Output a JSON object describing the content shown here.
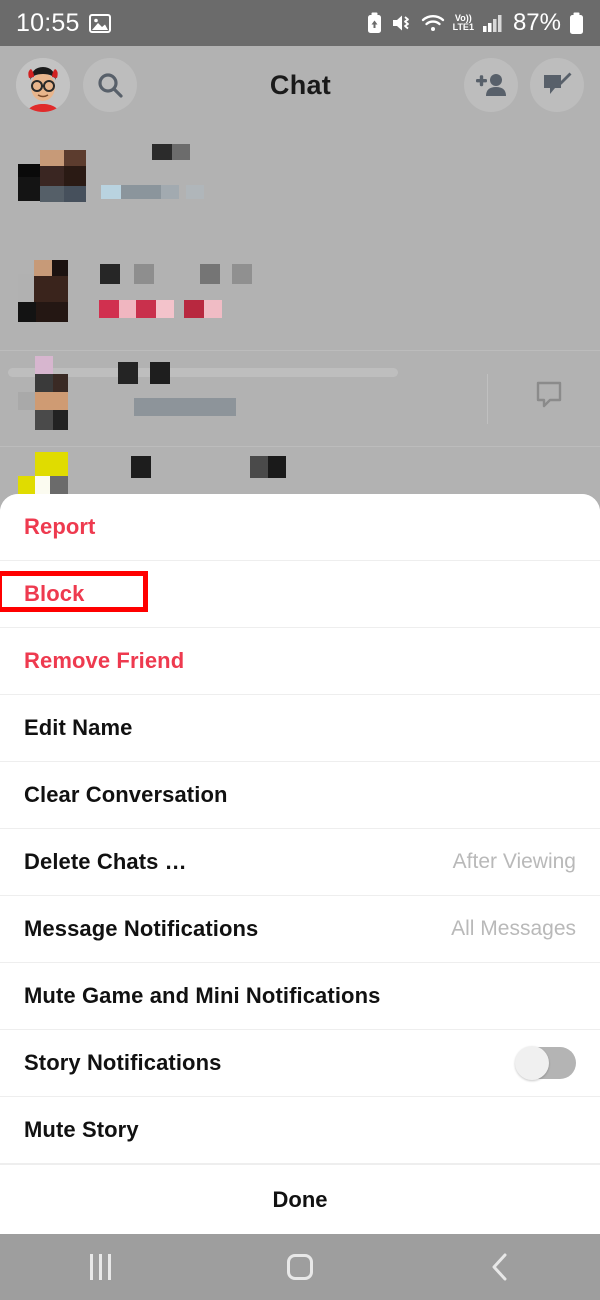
{
  "status_bar": {
    "time": "10:55",
    "image_icon": "image-icon",
    "screenshot_icon": "screen-record-icon",
    "mute_icon": "volume-mute-icon",
    "wifi_icon": "wifi-icon",
    "volte_top": "Vo))",
    "volte_bottom": "LTE1",
    "signal_icon": "cellular-signal-icon",
    "battery_percent": "87%",
    "battery_icon": "battery-icon"
  },
  "header": {
    "avatar": "bitmoji-avatar",
    "search_icon": "search-icon",
    "title": "Chat",
    "add_friend_icon": "add-friend-icon",
    "new_chat_icon": "new-chat-icon"
  },
  "chat_list": {
    "received_icon": "chat-received-icon",
    "received_text": "Received · 2w",
    "row_bubble_icon": "chat-bubble-icon"
  },
  "sheet": {
    "items": [
      {
        "label": "Report",
        "style": "danger",
        "value": "",
        "control": "none"
      },
      {
        "label": "Block",
        "style": "danger",
        "value": "",
        "control": "none"
      },
      {
        "label": "Remove Friend",
        "style": "danger",
        "value": "",
        "control": "none"
      },
      {
        "label": "Edit Name",
        "style": "normal",
        "value": "",
        "control": "none"
      },
      {
        "label": "Clear Conversation",
        "style": "normal",
        "value": "",
        "control": "none"
      },
      {
        "label": "Delete Chats …",
        "style": "normal",
        "value": "After Viewing",
        "control": "none"
      },
      {
        "label": "Message Notifications",
        "style": "normal",
        "value": "All Messages",
        "control": "none"
      },
      {
        "label": "Mute Game and Mini Notifications",
        "style": "normal",
        "value": "",
        "control": "none"
      },
      {
        "label": "Story Notifications",
        "style": "normal",
        "value": "",
        "control": "toggle",
        "toggle_on": false
      },
      {
        "label": "Mute Story",
        "style": "normal",
        "value": "",
        "control": "none"
      }
    ],
    "done_label": "Done"
  },
  "nav_bar": {
    "recents_icon": "recents-icon",
    "home_icon": "home-icon",
    "back_icon": "back-icon"
  },
  "annotation": {
    "highlight_target": "Block",
    "highlight_color": "#ff0000"
  },
  "colors": {
    "danger": "#ee3a4f",
    "sheet_bg": "#ffffff",
    "dim_backdrop": "#b2b2b2",
    "status_bar": "#6b6b6b",
    "nav_bar": "#9e9e9e"
  }
}
